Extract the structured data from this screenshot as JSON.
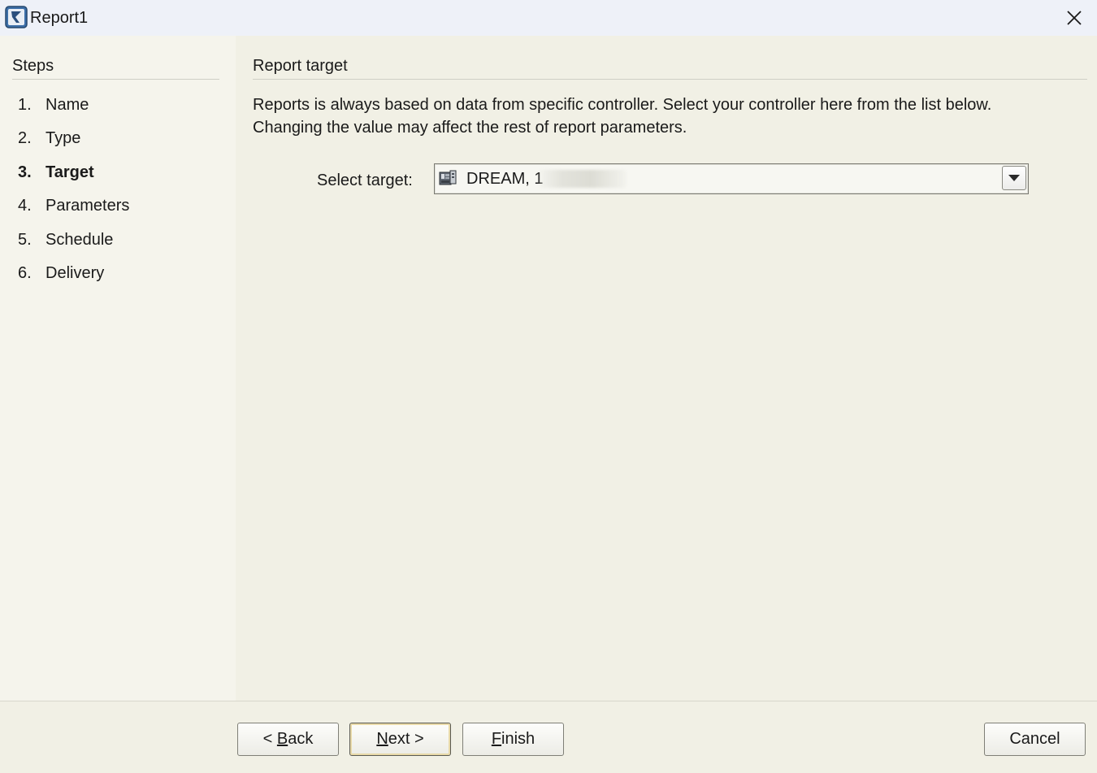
{
  "window": {
    "title": "Report1"
  },
  "steps": {
    "heading": "Steps",
    "items": [
      {
        "num": "1.",
        "label": "Name",
        "active": false
      },
      {
        "num": "2.",
        "label": "Type",
        "active": false
      },
      {
        "num": "3.",
        "label": "Target",
        "active": true
      },
      {
        "num": "4.",
        "label": "Parameters",
        "active": false
      },
      {
        "num": "5.",
        "label": "Schedule",
        "active": false
      },
      {
        "num": "6.",
        "label": "Delivery",
        "active": false
      }
    ]
  },
  "main": {
    "section_title": "Report target",
    "description_line1": "Reports is always based on data from specific controller. Select your controller here from the list below.",
    "description_line2": "Changing the value may affect the rest of report parameters.",
    "target_label": "Select target:",
    "target_value": "DREAM, 1",
    "target_icon": "controller-icon"
  },
  "footer": {
    "back": {
      "prefix": "< ",
      "mnemonic": "B",
      "rest": "ack"
    },
    "next": {
      "mnemonic": "N",
      "rest": "ext >"
    },
    "finish": {
      "mnemonic": "F",
      "rest": "inish"
    },
    "cancel": "Cancel"
  },
  "colors": {
    "background": "#f1f0e5",
    "steps_panel": "#f5f4ec",
    "titlebar": "#eef1f8",
    "default_button_focus": "#e8d9a8"
  }
}
